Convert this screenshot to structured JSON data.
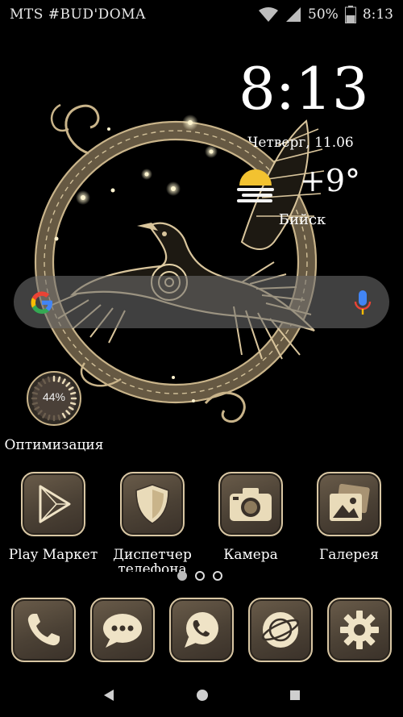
{
  "status_bar": {
    "carrier": "MTS #BUD'DOMA",
    "battery_percent": "50%",
    "battery_level": 0.5,
    "time": "8:13"
  },
  "clock_widget": {
    "time": "8:13",
    "date": "Четверг, 11.06",
    "temperature": "+9°",
    "city": "Бийск",
    "weather_icon": "sun-behind-fog-icon"
  },
  "search_bar": {
    "left_icon": "google-g-icon",
    "right_icon": "microphone-icon"
  },
  "optimization_widget": {
    "percent": "44%",
    "progress": 0.44,
    "label": "Оптимизация"
  },
  "apps": [
    {
      "label": "Play Маркет",
      "icon": "play-store-icon"
    },
    {
      "label": "Диспетчер телефона",
      "icon": "shield-icon"
    },
    {
      "label": "Камера",
      "icon": "camera-icon"
    },
    {
      "label": "Галерея",
      "icon": "gallery-icon"
    }
  ],
  "page_indicator": {
    "pages": 3,
    "active": 0
  },
  "dock": [
    {
      "icon": "phone-icon"
    },
    {
      "icon": "messages-icon"
    },
    {
      "icon": "whatsapp-icon"
    },
    {
      "icon": "browser-icon"
    },
    {
      "icon": "settings-gear-icon"
    }
  ],
  "nav_bar": {
    "back": "back-triangle-icon",
    "home": "home-circle-icon",
    "recents": "recents-square-icon"
  },
  "colors": {
    "background": "#000000",
    "gold": "#d8c6a3",
    "tile": "#4b4135",
    "wallpaper_line": "#c9b48a"
  }
}
